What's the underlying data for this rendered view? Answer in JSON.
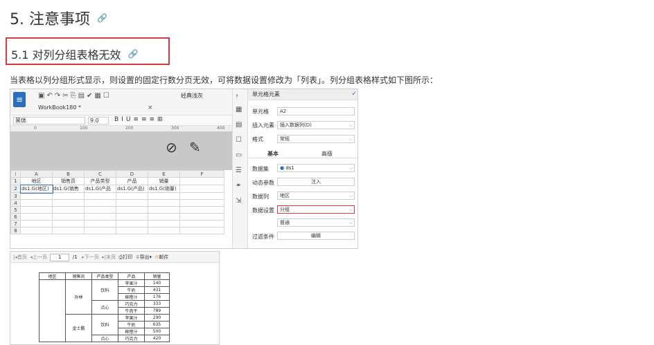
{
  "heading2": "5. 注意事项",
  "heading3": "5.1 对列分组表格无效",
  "link_icon": "🔗",
  "paragraph": "当表格以列分组形式显示，则设置的固定行数分页无效，可将数据设置修改为「列表」。列分组表格样式如下图所示：",
  "designer": {
    "style_label": "经典浅灰",
    "tab_name": "WorkBook180 *",
    "font": "黑体",
    "font_size": "9.0",
    "ruler": [
      "0",
      "100",
      "200",
      "300",
      "400"
    ],
    "col_headers": [
      "A",
      "B",
      "C",
      "D",
      "E",
      "F"
    ],
    "row_numbers": [
      "1",
      "2",
      "3",
      "4",
      "5",
      "6",
      "7",
      "8"
    ],
    "row1": [
      "地区",
      "销售员",
      "产品类型",
      "产品",
      "销量",
      ""
    ],
    "row2": [
      "ds1.G(地区)",
      "ds1.G(销售",
      "ds1.G(产品",
      "ds1.G(产品)",
      "ds1.G(销量)",
      ""
    ],
    "panel": {
      "title": "单元格元素",
      "cell_label": "单元格",
      "cell_value": "A2",
      "insert_label": "插入元素",
      "insert_value": "插入数据列(D)",
      "format_label": "格式",
      "format_value": "常规",
      "tab_basic": "基本",
      "tab_advanced": "高级",
      "dataset_label": "数据集",
      "dataset_value": "ds1",
      "dynamic_label": "动态参数",
      "dynamic_btn": "注入",
      "column_label": "数据列",
      "column_value": "地区",
      "setting_label": "数据设置",
      "setting_value": "分组",
      "setting_sub": "普通",
      "filter_label": "过滤条件",
      "filter_btn": "编辑"
    }
  },
  "preview": {
    "toolbar": {
      "first": "首页",
      "prev": "上一页",
      "page": "1",
      "total": "/1",
      "next": "下一页",
      "last": "末页",
      "print": "打印",
      "export": "导出",
      "mail": "邮件"
    },
    "headers": [
      "地区",
      "销售员",
      "产品类型",
      "产品",
      "销量"
    ],
    "rows": [
      [
        "",
        "孙林",
        "饮料",
        "苹果汁",
        "140"
      ],
      [
        "",
        "",
        "",
        "牛奶",
        "431"
      ],
      [
        "",
        "",
        "",
        "柳橙汁",
        "176"
      ],
      [
        "",
        "",
        "点心",
        "巧克力",
        "333"
      ],
      [
        "",
        "",
        "",
        "牛肉干",
        "789"
      ],
      [
        "",
        "金士鹏",
        "饮料",
        "苹果汁",
        "290"
      ],
      [
        "",
        "",
        "",
        "牛奶",
        "635"
      ],
      [
        "",
        "",
        "",
        "柳橙汁",
        "500"
      ],
      [
        "",
        "",
        "点心",
        "巧克力",
        "420"
      ]
    ]
  }
}
